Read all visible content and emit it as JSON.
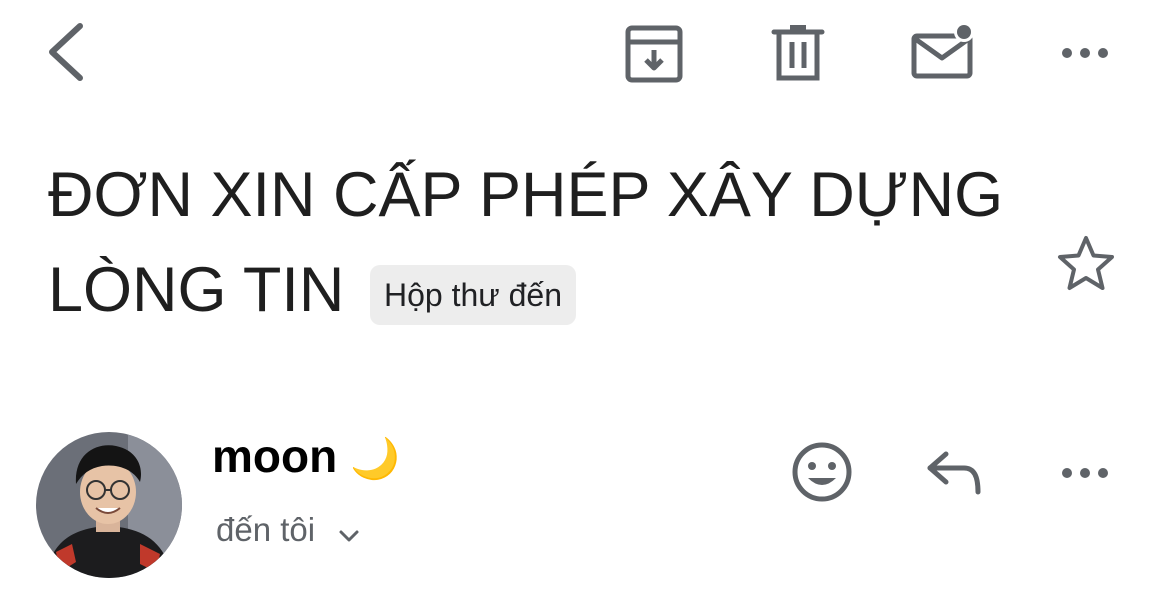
{
  "toolbar": {
    "back_icon": "chevron-left-icon",
    "archive_icon": "archive-icon",
    "delete_icon": "trash-icon",
    "mark_unread_icon": "mail-unread-icon",
    "more_icon": "more-horizontal-icon"
  },
  "message": {
    "subject_line1": "ĐƠN XIN CẤP PHÉP XÂY DỰNG",
    "subject_line2": "LÒNG TIN",
    "label": "Hộp thư đến",
    "star_icon": "star-outline-icon"
  },
  "sender": {
    "name": "moon",
    "name_emoji": "🌙",
    "recipient": "đến tôi",
    "recipient_icon": "chevron-down-icon",
    "actions": {
      "emoji_icon": "smiley-icon",
      "reply_icon": "reply-icon",
      "more_icon": "more-horizontal-icon"
    }
  },
  "colors": {
    "icon": "#5f6368",
    "text": "#1f1f1f",
    "label_bg": "#ededed",
    "secondary_text": "#5f6368"
  }
}
